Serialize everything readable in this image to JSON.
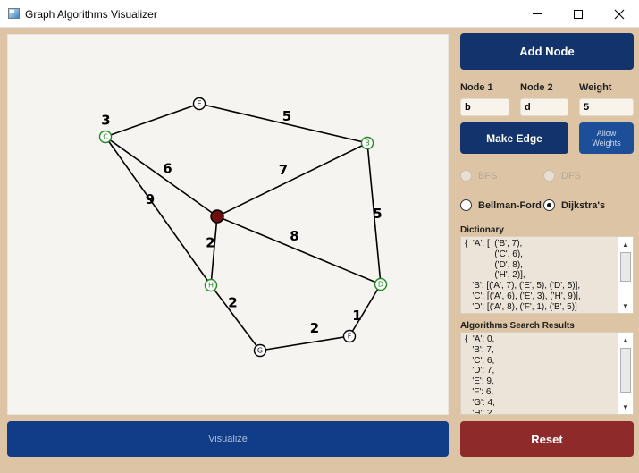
{
  "window": {
    "title": "Graph Algorithms Visualizer"
  },
  "buttons": {
    "add_node": "Add Node",
    "make_edge": "Make Edge",
    "allow_weights": "Allow Weights",
    "visualize": "Visualize",
    "reset": "Reset"
  },
  "inputs": {
    "node1_label": "Node 1",
    "node1_value": "b",
    "node2_label": "Node 2",
    "node2_value": "d",
    "weight_label": "Weight",
    "weight_value": "5"
  },
  "algorithms": {
    "bfs": "BFS",
    "dfs": "DFS",
    "bellman_ford": "Bellman-Ford",
    "dijkstra": "Dijkstra's",
    "selected": "Dijkstra's"
  },
  "dictionary": {
    "label": "Dictionary",
    "text": "{  'A': [  ('B', 7),\n            ('C', 6),\n            ('D', 8),\n            ('H', 2)],\n   'B': [('A', 7), ('E', 5), ('D', 5)],\n   'C': [('A', 6), ('E', 3), ('H', 9)],\n   'D': [('A', 8), ('F', 1), ('B', 5)]"
  },
  "results": {
    "label": "Algorithms Search Results",
    "text": "{  'A': 0,\n   'B': 7,\n   'C': 6,\n   'D': 7,\n   'E': 9,\n   'F': 6,\n   'G': 4,\n   'H': 2"
  },
  "graph": {
    "nodes": [
      {
        "id": "E",
        "label": "E",
        "color": "#000000",
        "start": false
      },
      {
        "id": "C",
        "label": "C",
        "color": "#1f8a1f",
        "start": false
      },
      {
        "id": "B",
        "label": "B",
        "color": "#1f8a1f",
        "start": false
      },
      {
        "id": "A",
        "label": "",
        "color": "#000000",
        "start": true,
        "fill": "#6b0f0f"
      },
      {
        "id": "H",
        "label": "H",
        "color": "#1f8a1f",
        "start": false
      },
      {
        "id": "D",
        "label": "D",
        "color": "#1f8a1f",
        "start": false
      },
      {
        "id": "F",
        "label": "F",
        "color": "#000000",
        "start": false
      },
      {
        "id": "G",
        "label": "G",
        "color": "#000000",
        "start": false
      }
    ],
    "edges": [
      {
        "from": "C",
        "to": "E",
        "weight": "3"
      },
      {
        "from": "E",
        "to": "B",
        "weight": "5"
      },
      {
        "from": "C",
        "to": "A",
        "weight": "6"
      },
      {
        "from": "A",
        "to": "B",
        "weight": "7"
      },
      {
        "from": "C",
        "to": "H",
        "weight": "9"
      },
      {
        "from": "B",
        "to": "D",
        "weight": "5"
      },
      {
        "from": "A",
        "to": "H",
        "weight": "2"
      },
      {
        "from": "A",
        "to": "D",
        "weight": "8"
      },
      {
        "from": "D",
        "to": "F",
        "weight": "1"
      },
      {
        "from": "H",
        "to": "G",
        "weight": "2"
      },
      {
        "from": "G",
        "to": "F",
        "weight": "2"
      }
    ]
  }
}
